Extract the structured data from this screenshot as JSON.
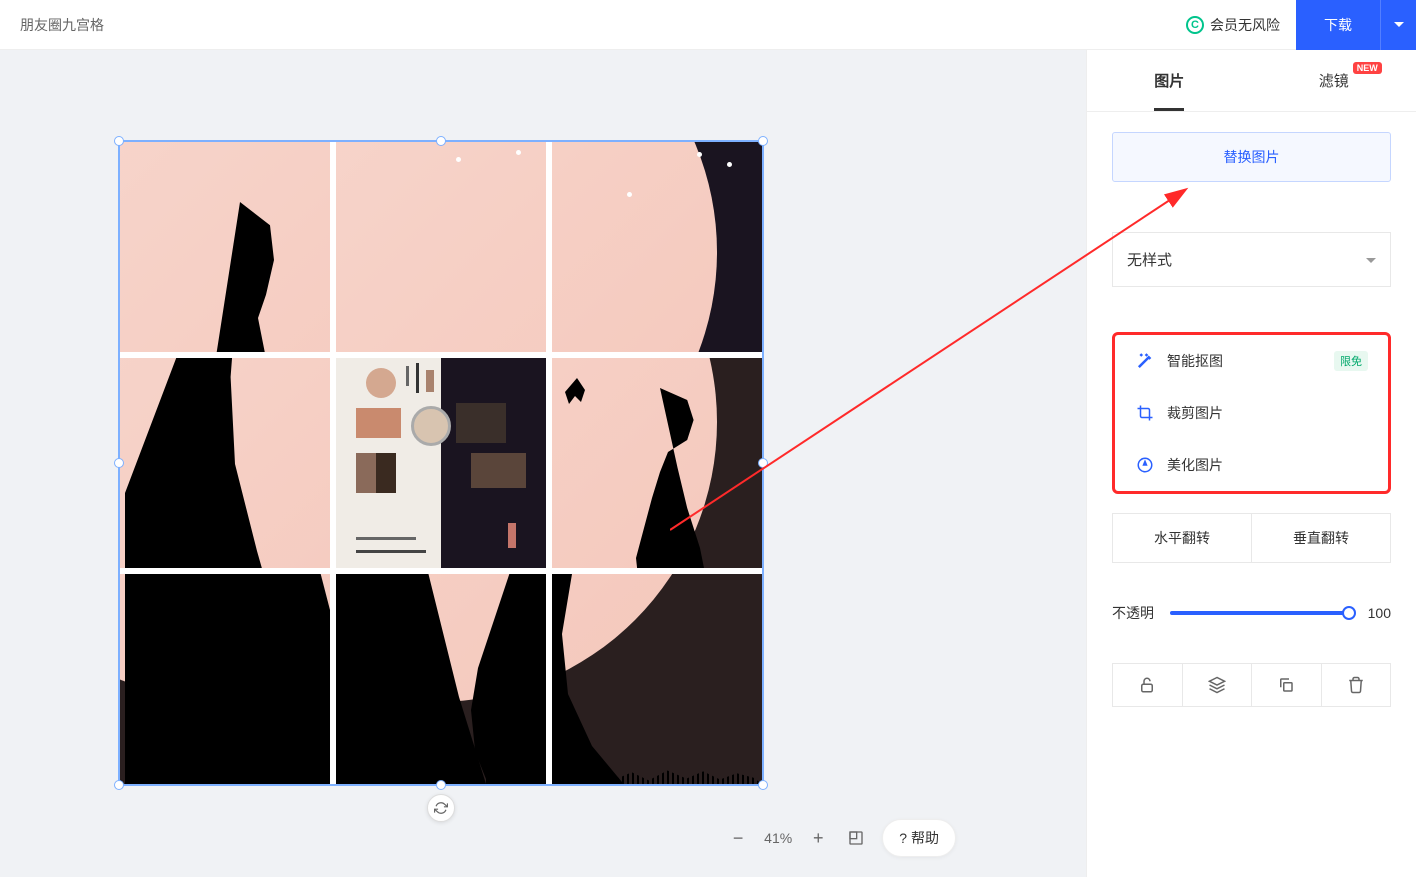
{
  "header": {
    "title": "朋友圈九宫格",
    "vip_status": "会员无风险",
    "download_label": "下载"
  },
  "canvas": {
    "zoom_pct": "41%",
    "help_label": "帮助"
  },
  "side_panel": {
    "tabs": {
      "image": "图片",
      "filter": "滤镜",
      "filter_badge": "NEW"
    },
    "replace_btn": "替换图片",
    "style_select": "无样式",
    "tools": {
      "smart_cutout": "智能抠图",
      "smart_cutout_tag": "限免",
      "crop": "裁剪图片",
      "beautify": "美化图片"
    },
    "flip": {
      "horizontal": "水平翻转",
      "vertical": "垂直翻转"
    },
    "opacity": {
      "label": "不透明",
      "value": "100"
    }
  }
}
